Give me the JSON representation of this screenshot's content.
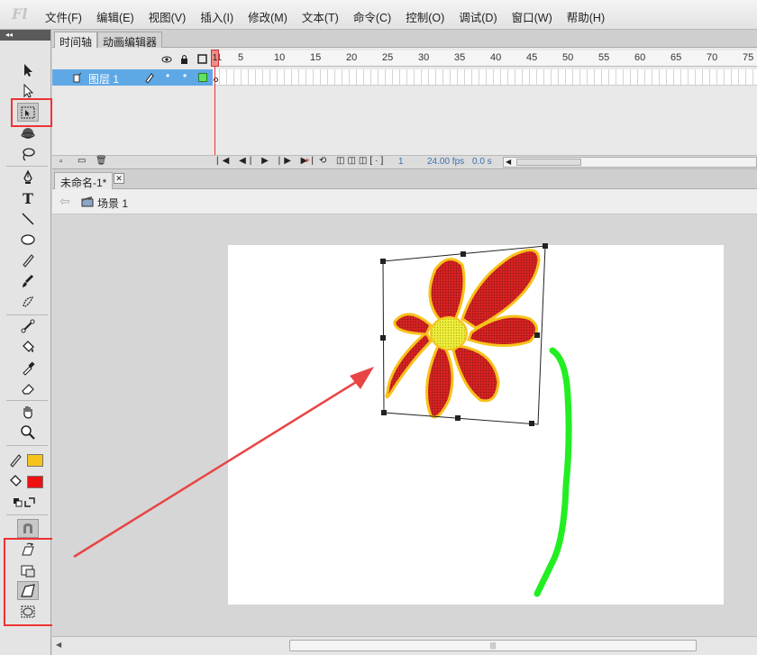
{
  "app": {
    "logo": "Fl"
  },
  "menu": [
    "文件(F)",
    "编辑(E)",
    "视图(V)",
    "插入(I)",
    "修改(M)",
    "文本(T)",
    "命令(C)",
    "控制(O)",
    "调试(D)",
    "窗口(W)",
    "帮助(H)"
  ],
  "timeline": {
    "tabs": [
      "时间轴",
      "动画编辑器"
    ],
    "ruler": [
      "1",
      "5",
      "10",
      "15",
      "20",
      "25",
      "30",
      "35",
      "40",
      "45",
      "50",
      "55",
      "60",
      "65",
      "70",
      "75"
    ],
    "layer_name": "图层 1",
    "current_frame": "1",
    "fps": "24.00 fps",
    "time": "0.0 s",
    "frame_field": "1"
  },
  "document": {
    "tab": "未命名-1*",
    "scene": "场景 1"
  },
  "colors": {
    "stroke": "#f7c21a",
    "fill": "#ee1111",
    "petal": "#d42222",
    "center": "#ecec3a",
    "stem": "#22ee22",
    "arrow": "#e84545",
    "highlight": "#e33333"
  },
  "tools": [
    "selection-icon",
    "subselection-icon",
    "free-transform-icon",
    "3d-rotation-icon",
    "lasso-icon",
    "pen-icon",
    "text-icon",
    "line-icon",
    "oval-icon",
    "pencil-icon",
    "brush-icon",
    "deco-icon",
    "bone-icon",
    "paint-bucket-icon",
    "eyedropper-icon",
    "eraser-icon",
    "hand-icon",
    "zoom-icon"
  ],
  "options": [
    "snap-to-objects-icon",
    "rotate-skew-icon",
    "scale-icon",
    "distort-icon",
    "envelope-icon"
  ]
}
